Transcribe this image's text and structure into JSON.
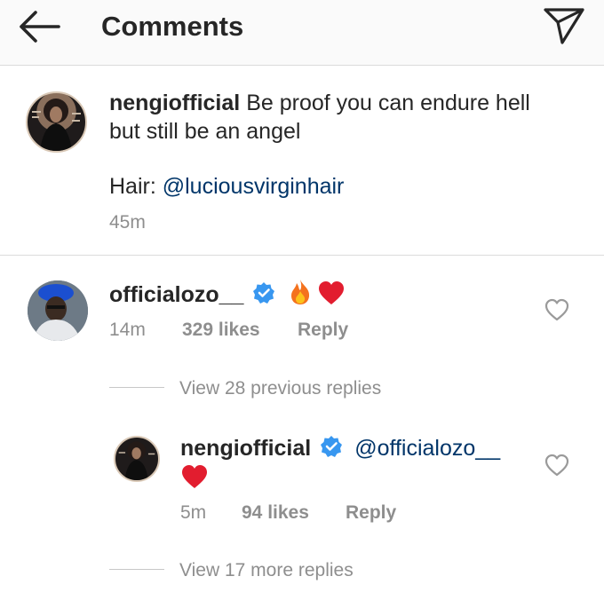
{
  "header": {
    "title": "Comments",
    "back_icon": "arrow-left-icon",
    "share_icon": "paper-plane-icon"
  },
  "caption": {
    "username": "nengiofficial",
    "text_line1": "Be proof you can endure hell",
    "text_line2": "but still be an angel",
    "hair_label": "Hair:",
    "hair_mention": "@luciousvirginhair",
    "time": "45m"
  },
  "comment": {
    "username": "officialozo__",
    "verified": true,
    "emojis": [
      "fire",
      "red-heart"
    ],
    "time": "14m",
    "likes": "329 likes",
    "reply_label": "Reply",
    "view_replies": "View 28 previous replies"
  },
  "reply": {
    "username": "nengiofficial",
    "verified": true,
    "mention": "@officialozo__",
    "emojis": [
      "red-heart"
    ],
    "time": "5m",
    "likes": "94 likes",
    "reply_label": "Reply",
    "view_more": "View 17 more replies"
  },
  "colors": {
    "link": "#003569",
    "verified_badge": "#3897f0",
    "meta_text": "#8e8e8e",
    "header_bg": "#fafafa"
  }
}
